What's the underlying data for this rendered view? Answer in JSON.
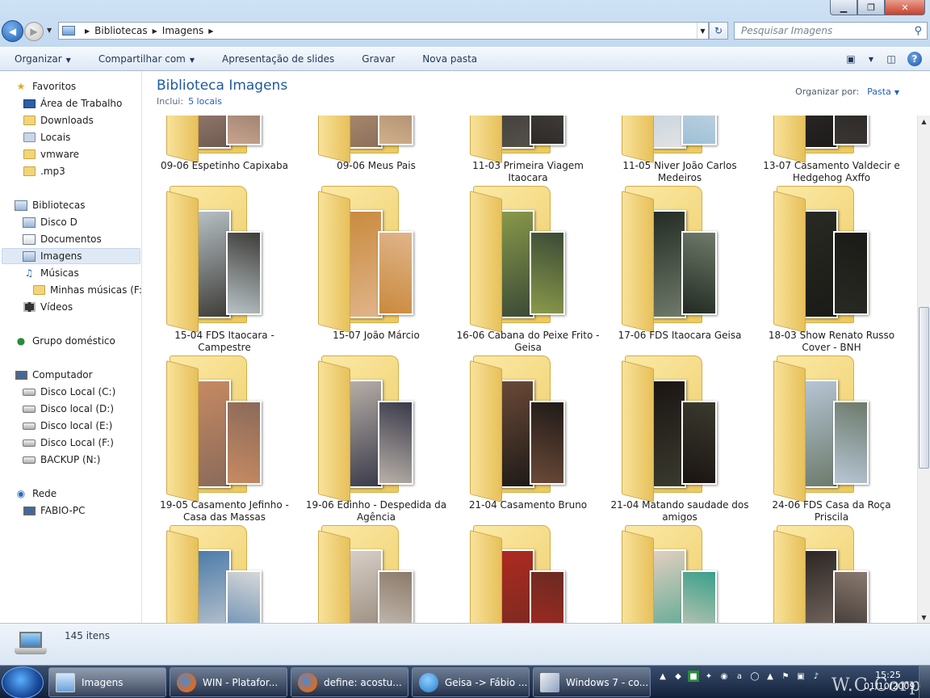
{
  "window": {
    "minimize_label": "▁",
    "maximize_label": "❐",
    "close_label": "✕"
  },
  "address_bar": {
    "crumbs": [
      "Bibliotecas",
      "Imagens"
    ]
  },
  "search": {
    "placeholder": "Pesquisar Imagens",
    "icon": "search-icon"
  },
  "toolbar": {
    "organize": "Organizar",
    "share": "Compartilhar com",
    "slideshow": "Apresentação de slides",
    "burn": "Gravar",
    "new_folder": "Nova pasta"
  },
  "nav": {
    "favorites": {
      "title": "Favoritos",
      "items": [
        "Área de Trabalho",
        "Downloads",
        "Locais",
        "vmware",
        ".mp3"
      ]
    },
    "libraries": {
      "title": "Bibliotecas",
      "items": [
        "Disco D",
        "Documentos",
        "Imagens",
        "Músicas",
        "Minhas músicas (F:)",
        "Vídeos"
      ]
    },
    "homegroup": "Grupo doméstico",
    "computer": {
      "title": "Computador",
      "items": [
        "Disco Local (C:)",
        "Disco local (D:)",
        "Disco local (E:)",
        "Disco Local (F:)",
        "BACKUP (N:)"
      ]
    },
    "network": {
      "title": "Rede",
      "items": [
        "FABIO-PC"
      ]
    }
  },
  "library": {
    "title": "Biblioteca Imagens",
    "includes_label": "Inclui:",
    "includes_link": "5 locais",
    "arrange_label": "Organizar por:",
    "arrange_value": "Pasta"
  },
  "folders": [
    {
      "name": "09-06 Espetinho Capixaba",
      "colors": [
        "#c9a48e",
        "#6d5a52"
      ]
    },
    {
      "name": "09-06 Meus Pais",
      "colors": [
        "#d2b08a",
        "#8c6f5a"
      ]
    },
    {
      "name": "11-03 Primeira Viagem Itaocara",
      "colors": [
        "#2d2a28",
        "#54504a"
      ]
    },
    {
      "name": "11-05 Niver João Carlos Medeiros",
      "colors": [
        "#9cc0d8",
        "#e3e3e3"
      ]
    },
    {
      "name": "13-07 Casamento Valdecir e Hedgehog Axffo",
      "colors": [
        "#3a3633",
        "#1d1b1a"
      ]
    },
    {
      "name": "15-04 FDS Itaocara - Campestre",
      "colors": [
        "#b8c2c6",
        "#3e3c38"
      ]
    },
    {
      "name": "15-07 João Márcio",
      "colors": [
        "#c98a3d",
        "#e0b48a"
      ]
    },
    {
      "name": "16-06 Cabana do Peixe Frito - Geisa",
      "colors": [
        "#8a9a4a",
        "#3b4a36"
      ]
    },
    {
      "name": "17-06 FDS Itaocara Geisa",
      "colors": [
        "#222a22",
        "#6f7a6a"
      ]
    },
    {
      "name": "18-03 Show Renato Russo Cover - BNH",
      "colors": [
        "#2a2a24",
        "#1a1a16"
      ]
    },
    {
      "name": "19-05 Casamento Jefinho - Casa das Massas",
      "colors": [
        "#c78a62",
        "#8a6a5a"
      ]
    },
    {
      "name": "19-06 Edinho - Despedida da Agência",
      "colors": [
        "#b8b0a8",
        "#3a3a4a"
      ]
    },
    {
      "name": "21-04 Casamento Bruno",
      "colors": [
        "#6b4a38",
        "#1f1a18"
      ]
    },
    {
      "name": "21-04 Matando saudade dos amigos",
      "colors": [
        "#1a1412",
        "#3a3a2e"
      ]
    },
    {
      "name": "24-06 FDS Casa da Roça Priscila",
      "colors": [
        "#b7c6d6",
        "#6c7a6a"
      ]
    },
    {
      "name": "",
      "colors": [
        "#4a7aa8",
        "#d8d8d8"
      ]
    },
    {
      "name": "",
      "colors": [
        "#d8d0c8",
        "#8a7a6a"
      ]
    },
    {
      "name": "",
      "colors": [
        "#b02a20",
        "#6a2a22"
      ]
    },
    {
      "name": "",
      "colors": [
        "#e6d0c0",
        "#3aa08a"
      ]
    },
    {
      "name": "",
      "colors": [
        "#2a2422",
        "#8a7a70"
      ]
    }
  ],
  "status": {
    "item_count": "145 itens"
  },
  "taskbar": {
    "tasks": [
      {
        "label": "Imagens",
        "icon": "explorer-icon"
      },
      {
        "label": "WIN - Platafor...",
        "icon": "firefox-icon"
      },
      {
        "label": "define: acostu...",
        "icon": "firefox-icon"
      },
      {
        "label": "Geisa -> Fábio ...",
        "icon": "messenger-icon"
      },
      {
        "label": "Windows 7 - co...",
        "icon": "paint-icon"
      }
    ],
    "time": "15:25",
    "date": "01/10/2009",
    "watermark": "W.C.Corp"
  },
  "colors": {
    "accent": "#1e5aa0",
    "link": "#1f5fbf",
    "taskbar": "#1a2b48"
  }
}
